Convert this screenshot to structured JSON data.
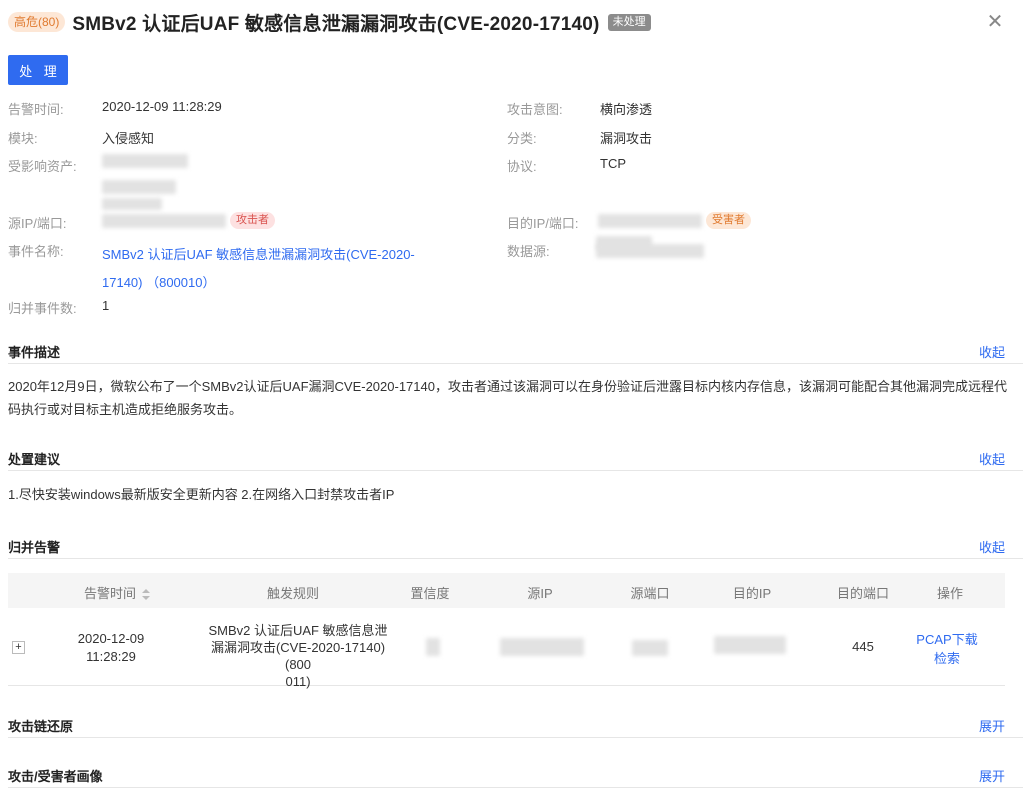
{
  "header": {
    "severity_badge": "高危(80)",
    "title": "SMBv2 认证后UAF 敏感信息泄漏漏洞攻击(CVE-2020-17140)",
    "status_badge": "未处理",
    "close_icon": "close-icon"
  },
  "actions": {
    "process_label": "处 理"
  },
  "fields": {
    "alert_time": {
      "label": "告警时间:",
      "value": "2020-12-09 11:28:29"
    },
    "module": {
      "label": "模块:",
      "value": "入侵感知"
    },
    "affected_asset": {
      "label": "受影响资产:"
    },
    "src_ip_port": {
      "label": "源IP/端口:",
      "tag": "攻击者"
    },
    "event_name": {
      "label": "事件名称:",
      "value_line1": "SMBv2 认证后UAF 敏感信息泄漏漏洞攻击(CVE-2020-",
      "value_line2": "17140) （800010）"
    },
    "merged_count": {
      "label": "归并事件数:",
      "value": "1"
    },
    "attack_intent": {
      "label": "攻击意图:",
      "value": "横向渗透"
    },
    "category": {
      "label": "分类:",
      "value": "漏洞攻击"
    },
    "protocol": {
      "label": "协议:",
      "value": "TCP"
    },
    "dst_ip_port": {
      "label": "目的IP/端口:",
      "tag": "受害者"
    },
    "data_source": {
      "label": "数据源:"
    }
  },
  "sections": {
    "description": {
      "title": "事件描述",
      "toggle": "收起",
      "text": "2020年12月9日，微软公布了一个SMBv2认证后UAF漏洞CVE-2020-17140，攻击者通过该漏洞可以在身份验证后泄露目标内核内存信息，该漏洞可能配合其他漏洞完成远程代码执行或对目标主机造成拒绝服务攻击。"
    },
    "advice": {
      "title": "处置建议",
      "toggle": "收起",
      "text": "1.尽快安装windows最新版安全更新内容 2.在网络入口封禁攻击者IP"
    },
    "merged_alerts": {
      "title": "归并告警",
      "toggle": "收起"
    },
    "attack_chain": {
      "title": "攻击链还原",
      "toggle": "展开"
    },
    "profile": {
      "title": "攻击/受害者画像",
      "toggle": "展开"
    }
  },
  "table": {
    "columns": [
      "告警时间",
      "触发规则",
      "置信度",
      "源IP",
      "源端口",
      "目的IP",
      "目的端口",
      "操作"
    ],
    "rows": [
      {
        "expand": "+",
        "time_line1": "2020-12-09",
        "time_line2": "11:28:29",
        "rule_line1": "SMBv2 认证后UAF 敏感信息泄",
        "rule_line2": "漏漏洞攻击(CVE-2020-17140) (800",
        "rule_line3": "011)",
        "dst_port": "445",
        "op_pcap": "PCAP下载",
        "op_search": "检索"
      }
    ]
  }
}
